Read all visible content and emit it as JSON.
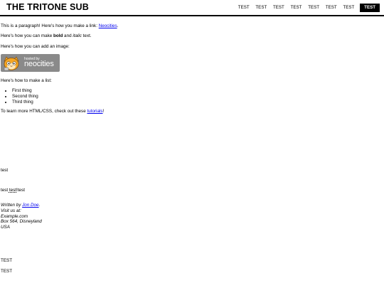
{
  "header": {
    "title": "THE TRITONE SUB",
    "nav": [
      "TEST",
      "TEST",
      "TEST",
      "TEST",
      "TEST",
      "TEST",
      "TEST"
    ],
    "nav_active": "TEST"
  },
  "content": {
    "p1_prefix": "This is a paragraph! Here's how you make a link: ",
    "p1_link": "Neocities",
    "p1_suffix": ".",
    "p2_prefix": "Here's how you can make ",
    "p2_bold": "bold",
    "p2_mid": " and ",
    "p2_italic": "italic",
    "p2_suffix": " text.",
    "p3": "Here's how you can add an image:",
    "badge_hosted": "hosted by",
    "badge_brand": "neocities",
    "p4": "Here's how to make a list:",
    "list": [
      "First thing",
      "Second thing",
      "Third thing"
    ],
    "p5_prefix": "To learn more HTML/CSS, check out these ",
    "p5_link": "tutorials",
    "p5_suffix": "!",
    "test1": "test",
    "test2_a": "test ",
    "test2_b": "test!",
    "test2_c": "test",
    "author_prefix": "Written by ",
    "author_link": "Jon Doe",
    "author_suffix": ".",
    "address": [
      "Visit us at:",
      "Example.com",
      "Box 564, Disneyland",
      "USA"
    ],
    "test3": "TEST",
    "test4": "TEST"
  }
}
